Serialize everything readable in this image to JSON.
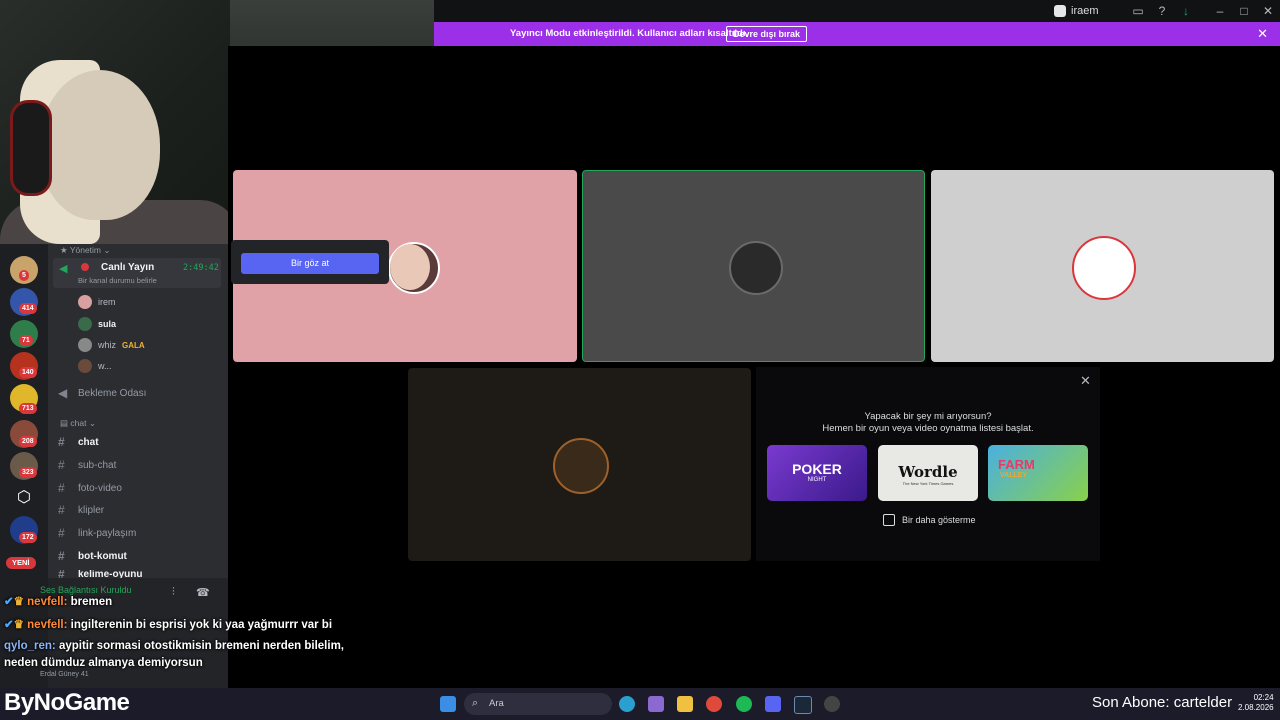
{
  "window": {
    "title": "iraem"
  },
  "banner": {
    "message": "Yayıncı Modu etkinleştirildi. Kullanıcı adları kısaltıldı.",
    "button": "Devre dışı bırak"
  },
  "servers": [
    {
      "badge": "5"
    },
    {
      "badge": "414"
    },
    {
      "badge": "71"
    },
    {
      "badge": "140"
    },
    {
      "badge": "713"
    },
    {
      "badge": "208"
    },
    {
      "badge": "323"
    },
    {
      "badge": ""
    },
    {
      "badge": "172"
    }
  ],
  "new_badge": "YENİ",
  "sidebar": {
    "category_management": "Yönetim",
    "live_channel": "Canlı Yayın",
    "live_timer": "2:49:42",
    "channel_status": "Bir kanal durumu belirle",
    "members": [
      {
        "name": "irem"
      },
      {
        "name": "sula"
      },
      {
        "name": "whiz",
        "tag": "GALA"
      },
      {
        "name": "w..."
      }
    ],
    "waiting_room": "Bekleme Odası",
    "category_chat": "chat",
    "channels": [
      {
        "name": "chat"
      },
      {
        "name": "sub-chat"
      },
      {
        "name": "foto-video"
      },
      {
        "name": "klipler"
      },
      {
        "name": "link-paylaşım"
      },
      {
        "name": "bot-komut"
      },
      {
        "name": "kelime-oyunu"
      }
    ],
    "voice_status": "Ses Bağlantısı Kuruldu",
    "footer_user": "Erdal Güney 41"
  },
  "popup": {
    "button": "Bir göz at"
  },
  "activity": {
    "q1": "Yapacak bir şey mi arıyorsun?",
    "q2": "Hemen bir oyun veya video oynatma listesi başlat.",
    "games": [
      {
        "name": "POKER",
        "sub": "NIGHT"
      },
      {
        "name": "Wordle",
        "sub": "The New York Times Games"
      },
      {
        "name": "FARM",
        "sub": "VALLEY"
      }
    ],
    "checkbox_label": "Bir daha gösterme"
  },
  "chat_overlay": [
    {
      "user": "nevfell:",
      "message": "bremen"
    },
    {
      "user": "nevfell:",
      "message": "ingilterenin bi esprisi yok ki yaa yağmurrr var bi"
    },
    {
      "user": "qylo_ren:",
      "message": "aypitir sormasi otostikmisin bremeni nerden bilelim,"
    },
    {
      "user": "",
      "message": "neden dümduz almanya demiyorsun"
    }
  ],
  "branding": {
    "logo": "ByNoGame",
    "subscriber": "Son Abone: cartelder"
  },
  "taskbar": {
    "search": "Ara",
    "time": "02:24",
    "date": "2.08.2026"
  },
  "colors": {
    "banner": "#9b30e8",
    "accent": "#5865f2",
    "live": "#da373c"
  }
}
